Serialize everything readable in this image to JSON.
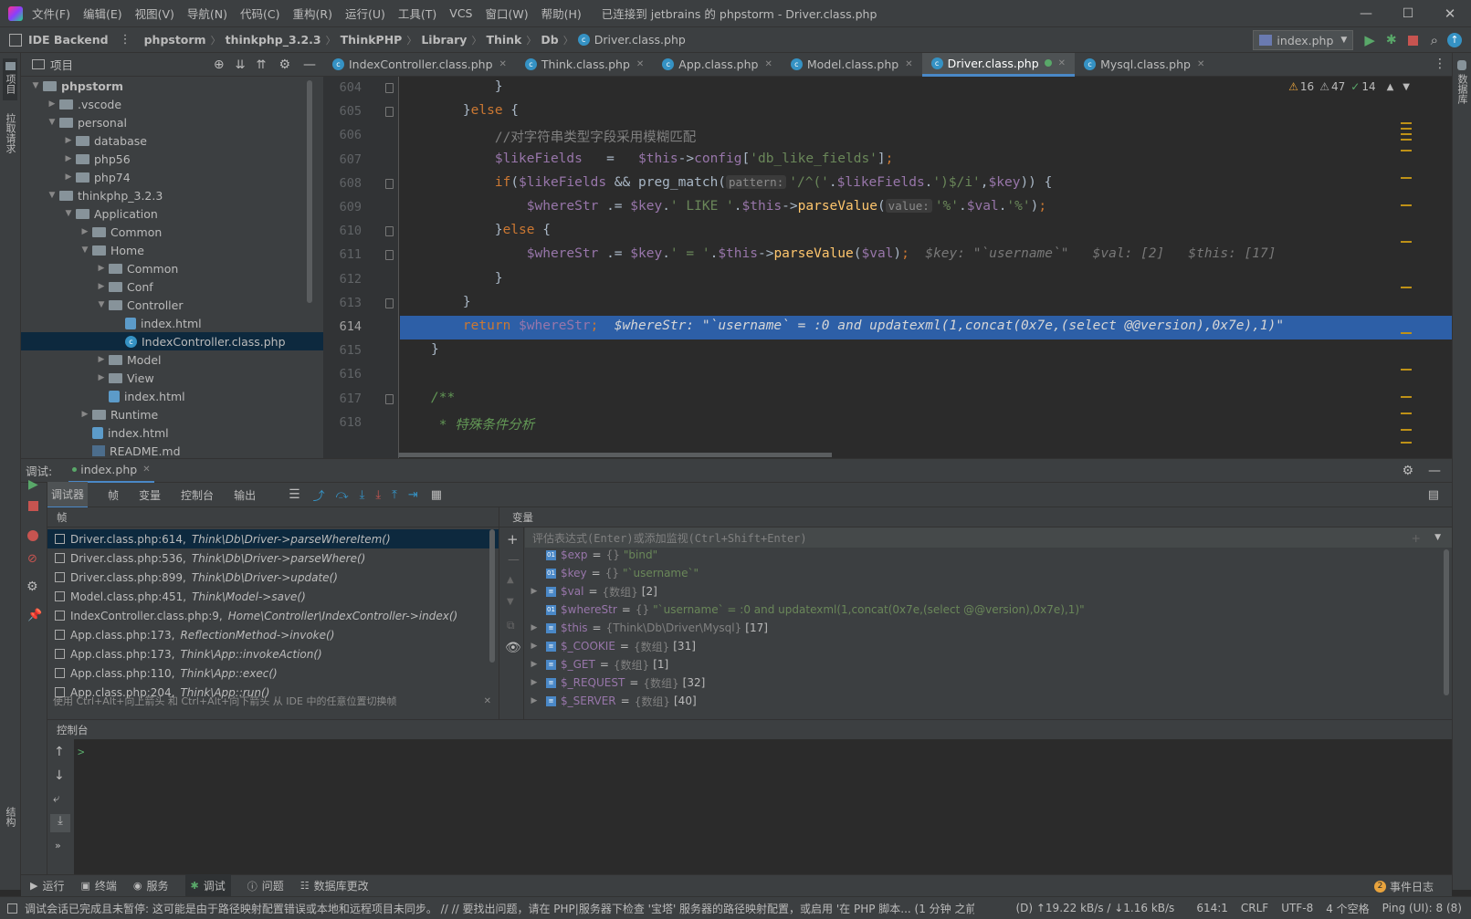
{
  "title": {
    "menu": [
      "文件(F)",
      "编辑(E)",
      "视图(V)",
      "导航(N)",
      "代码(C)",
      "重构(R)",
      "运行(U)",
      "工具(T)",
      "VCS",
      "窗口(W)",
      "帮助(H)"
    ],
    "window_title": "已连接到 jetbrains 的 phpstorm - Driver.class.php"
  },
  "nav": {
    "project_name": "IDE Backend",
    "breadcrumbs": [
      "phpstorm",
      "thinkphp_3.2.3",
      "ThinkPHP",
      "Library",
      "Think",
      "Db",
      "Driver.class.php"
    ],
    "run_config": "index.php"
  },
  "left_strip": {
    "project": "项目",
    "pull": "拉取请求",
    "structure": "结构"
  },
  "right_strip": {
    "database": "数据库"
  },
  "project_panel": {
    "title": "项目",
    "tree": [
      {
        "label": "phpstorm",
        "depth": 0,
        "open": true,
        "kind": "folder",
        "bold": true
      },
      {
        "label": ".vscode",
        "depth": 1,
        "open": false,
        "kind": "folder"
      },
      {
        "label": "personal",
        "depth": 1,
        "open": true,
        "kind": "folder"
      },
      {
        "label": "database",
        "depth": 2,
        "open": false,
        "kind": "folder"
      },
      {
        "label": "php56",
        "depth": 2,
        "open": false,
        "kind": "folder"
      },
      {
        "label": "php74",
        "depth": 2,
        "open": false,
        "kind": "folder"
      },
      {
        "label": "thinkphp_3.2.3",
        "depth": 1,
        "open": true,
        "kind": "folder"
      },
      {
        "label": "Application",
        "depth": 2,
        "open": true,
        "kind": "folder"
      },
      {
        "label": "Common",
        "depth": 3,
        "open": false,
        "kind": "folder"
      },
      {
        "label": "Home",
        "depth": 3,
        "open": true,
        "kind": "folder"
      },
      {
        "label": "Common",
        "depth": 4,
        "open": false,
        "kind": "folder"
      },
      {
        "label": "Conf",
        "depth": 4,
        "open": false,
        "kind": "folder"
      },
      {
        "label": "Controller",
        "depth": 4,
        "open": true,
        "kind": "folder"
      },
      {
        "label": "index.html",
        "depth": 5,
        "kind": "html"
      },
      {
        "label": "IndexController.class.php",
        "depth": 5,
        "kind": "class",
        "selected": true
      },
      {
        "label": "Model",
        "depth": 4,
        "open": false,
        "kind": "folder"
      },
      {
        "label": "View",
        "depth": 4,
        "open": false,
        "kind": "folder"
      },
      {
        "label": "index.html",
        "depth": 4,
        "kind": "html"
      },
      {
        "label": "Runtime",
        "depth": 3,
        "open": false,
        "kind": "folder"
      },
      {
        "label": "index.html",
        "depth": 3,
        "kind": "html"
      },
      {
        "label": "README.md",
        "depth": 3,
        "kind": "md"
      }
    ]
  },
  "tabs": [
    {
      "label": "IndexController.class.php"
    },
    {
      "label": "Think.class.php"
    },
    {
      "label": "App.class.php"
    },
    {
      "label": "Model.class.php"
    },
    {
      "label": "Driver.class.php",
      "active": true
    },
    {
      "label": "Mysql.class.php"
    }
  ],
  "inspections": {
    "warnings": "16",
    "weak": "47",
    "ok": "14"
  },
  "editor": {
    "line_numbers": [
      "604",
      "605",
      "606",
      "607",
      "608",
      "609",
      "610",
      "611",
      "612",
      "613",
      "614",
      "615",
      "616",
      "617",
      "618"
    ],
    "current_line": "614",
    "hint_pattern": "pattern:",
    "hint_value": "value:",
    "inline_611": "$key: \"`username`\"   $val: [2]   $this: [17]",
    "inline_614": "$whereStr: \"`username` = :0 and updatexml(1,concat(0x7e,(select @@version),0x7e),1)\""
  },
  "debug": {
    "label": "调试:",
    "session_tab": "index.php",
    "tool_tabs": [
      "调试器",
      "帧",
      "变量",
      "控制台",
      "输出"
    ],
    "frames_header": "帧",
    "vars_header": "变量",
    "frames": [
      {
        "file": "Driver.class.php:614,",
        "method": "Think\\Db\\Driver->parseWhereItem()",
        "selected": true
      },
      {
        "file": "Driver.class.php:536,",
        "method": "Think\\Db\\Driver->parseWhere()"
      },
      {
        "file": "Driver.class.php:899,",
        "method": "Think\\Db\\Driver->update()"
      },
      {
        "file": "Model.class.php:451,",
        "method": "Think\\Model->save()"
      },
      {
        "file": "IndexController.class.php:9,",
        "method": "Home\\Controller\\IndexController->index()"
      },
      {
        "file": "App.class.php:173,",
        "method": "ReflectionMethod->invoke()"
      },
      {
        "file": "App.class.php:173,",
        "method": "Think\\App::invokeAction()"
      },
      {
        "file": "App.class.php:110,",
        "method": "Think\\App::exec()"
      },
      {
        "file": "App.class.php:204,",
        "method": "Think\\App::run()"
      }
    ],
    "frames_tip": "使用 Ctrl+Alt+向上箭头 和 Ctrl+Alt+向下箭头 从 IDE 中的任意位置切换帧",
    "eval_placeholder": "评估表达式(Enter)或添加监视(Ctrl+Shift+Enter)",
    "variables": [
      {
        "name": "$exp",
        "type": "{}",
        "value": "\"bind\"",
        "expandable": false
      },
      {
        "name": "$key",
        "type": "{}",
        "value": "\"`username`\"",
        "expandable": false
      },
      {
        "name": "$val",
        "type": "{数组}",
        "value": "[2]",
        "expandable": true
      },
      {
        "name": "$whereStr",
        "type": "{}",
        "value": "\"`username` = :0 and updatexml(1,concat(0x7e,(select @@version),0x7e),1)\"",
        "expandable": false
      },
      {
        "name": "$this",
        "type": "{Think\\Db\\Driver\\Mysql}",
        "value": "[17]",
        "expandable": true
      },
      {
        "name": "$_COOKIE",
        "type": "{数组}",
        "value": "[31]",
        "expandable": true
      },
      {
        "name": "$_GET",
        "type": "{数组}",
        "value": "[1]",
        "expandable": true
      },
      {
        "name": "$_REQUEST",
        "type": "{数组}",
        "value": "[32]",
        "expandable": true
      },
      {
        "name": "$_SERVER",
        "type": "{数组}",
        "value": "[40]",
        "expandable": true
      }
    ],
    "console_label": "控制台",
    "console_prompt": ">"
  },
  "bottom_tabs": [
    {
      "label": "运行",
      "icon": "play-icon"
    },
    {
      "label": "终端",
      "icon": "terminal-icon"
    },
    {
      "label": "服务",
      "icon": "services-icon"
    },
    {
      "label": "调试",
      "icon": "bug-icon",
      "active": true
    },
    {
      "label": "问题",
      "icon": "info-icon"
    },
    {
      "label": "数据库更改",
      "icon": "db-changes-icon"
    }
  ],
  "event_log": {
    "count": "2",
    "label": "事件日志"
  },
  "status": {
    "message": "调试会话已完成且未暂停: 这可能是由于路径映射配置错误或本地和远程项目未同步。 // // 要找出问题，请在 PHP|服务器下检查 '宝塔' 服务器的路径映射配置，或启用 '在 PHP 脚本... (1 分钟 之前)",
    "network": "(D) ↑19.22 kB/s / ↓1.16 kB/s",
    "position": "614:1",
    "line_sep": "CRLF",
    "encoding": "UTF-8",
    "indent": "4 个空格",
    "ping": "Ping (UI): 8 (8)"
  },
  "colors": {
    "accent": "#4a88c7",
    "bg_dark": "#2b2b2b",
    "panel": "#3c3f41",
    "selection": "#0d293e",
    "highlight_line": "#2d5fa7"
  }
}
